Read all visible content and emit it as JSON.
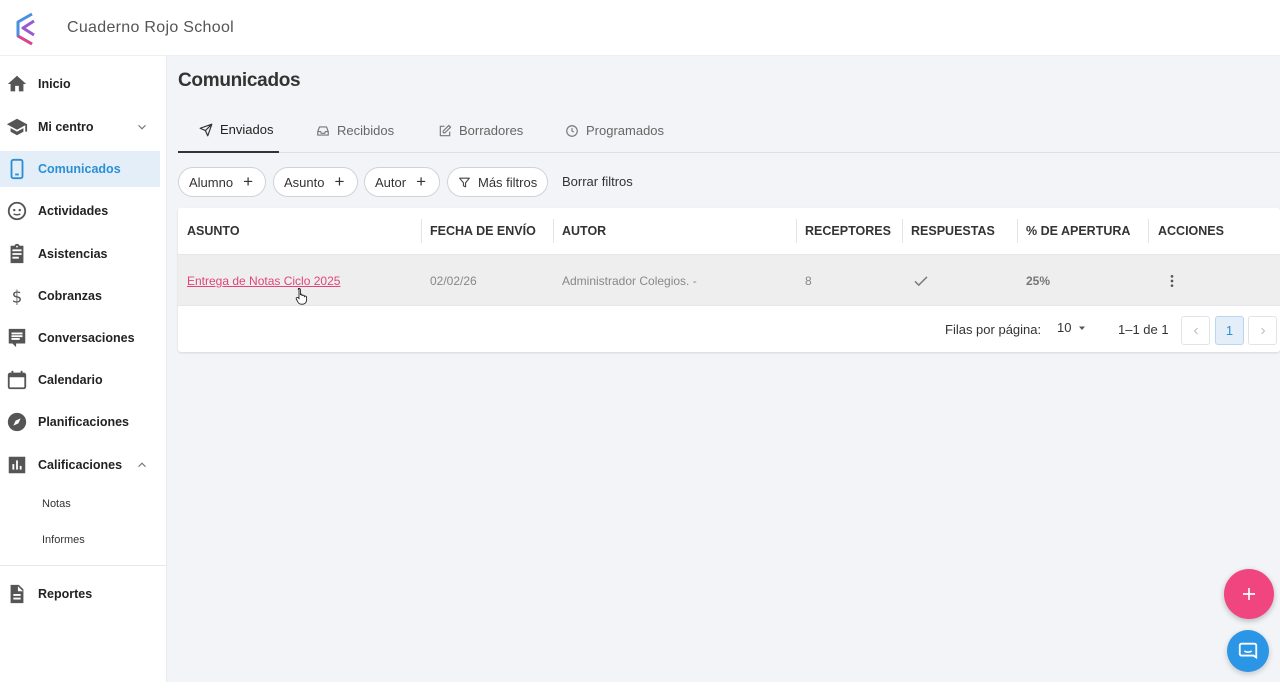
{
  "app": {
    "title": "Cuaderno Rojo School"
  },
  "sidebar": {
    "items": [
      {
        "label": "Inicio",
        "icon": "home-icon"
      },
      {
        "label": "Mi centro",
        "icon": "school-icon"
      },
      {
        "label": "Comunicados",
        "icon": "phone-icon"
      },
      {
        "label": "Actividades",
        "icon": "face-icon"
      },
      {
        "label": "Asistencias",
        "icon": "clipboard-icon"
      },
      {
        "label": "Cobranzas",
        "icon": "dollar-icon"
      },
      {
        "label": "Conversaciones",
        "icon": "chat-icon"
      },
      {
        "label": "Calendario",
        "icon": "calendar-icon"
      },
      {
        "label": "Planificaciones",
        "icon": "compass-icon"
      },
      {
        "label": "Calificaciones",
        "icon": "bar-chart-icon"
      },
      {
        "label": "Reportes",
        "icon": "document-icon"
      }
    ],
    "subitems": [
      {
        "label": "Notas"
      },
      {
        "label": "Informes"
      }
    ],
    "active": "Comunicados"
  },
  "main": {
    "title": "Comunicados",
    "tabs": [
      {
        "label": "Enviados",
        "icon": "send-icon"
      },
      {
        "label": "Recibidos",
        "icon": "inbox-icon"
      },
      {
        "label": "Borradores",
        "icon": "edit-icon"
      },
      {
        "label": "Programados",
        "icon": "clock-icon"
      }
    ],
    "active_tab": "Enviados",
    "filters": [
      {
        "label": "Alumno"
      },
      {
        "label": "Asunto"
      },
      {
        "label": "Autor"
      }
    ],
    "more_filters": "Más filtros",
    "clear_filters": "Borrar filtros"
  },
  "table": {
    "headers": [
      "ASUNTO",
      "FECHA DE ENVÍO",
      "AUTOR",
      "RECEPTORES",
      "RESPUESTAS",
      "% DE APERTURA",
      "ACCIONES"
    ],
    "rows": [
      {
        "subject": "Entrega de Notas Ciclo 2025",
        "date": "02/02/26",
        "author": "Administrador Colegios. -",
        "receivers": "8",
        "responses_icon": "check-icon",
        "open_rate": "25%",
        "actions_icon": "more-vert-icon"
      }
    ]
  },
  "pagination": {
    "rows_per_page_label": "Filas por página:",
    "rows_per_page": "10",
    "range": "1–1 de 1",
    "current_page": "1"
  },
  "colors": {
    "accent": "#2b8fd6",
    "link": "#e0457b",
    "fab": "#f0457e",
    "chat": "#2b95e6"
  }
}
